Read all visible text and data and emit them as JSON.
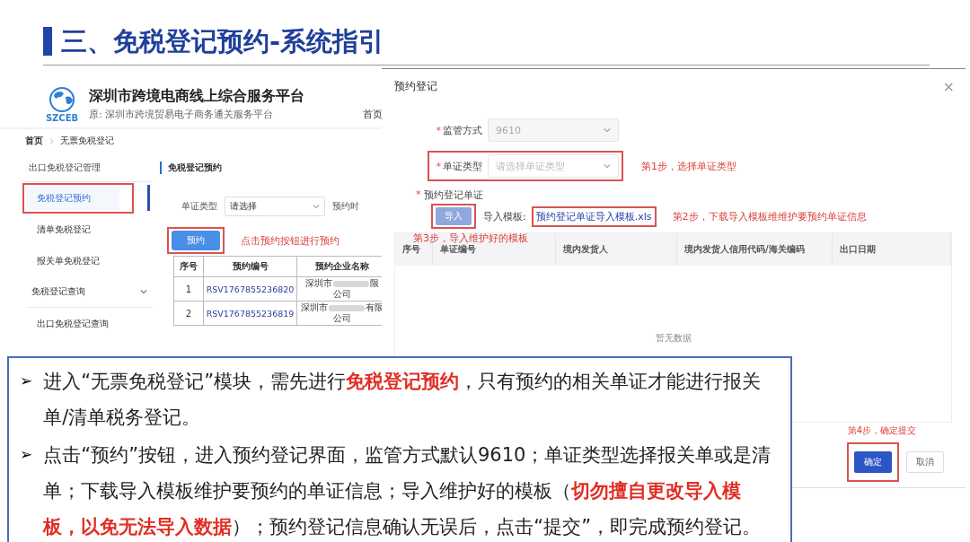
{
  "slide_title": "三、免税登记预约-系统指引",
  "portal": {
    "logo_text": "SZCEB",
    "title": "深圳市跨境电商线上综合服务平台",
    "subtitle": "原:  深圳市跨境贸易电子商务通关服务平台",
    "nav_link": "首页",
    "breadcrumb": [
      "首页",
      "无票免税登记"
    ],
    "sidebar": [
      {
        "label": "出口免税登记管理",
        "kind": "header",
        "selected": false,
        "highlighted": false
      },
      {
        "label": "免税登记预约",
        "kind": "item",
        "selected": true,
        "highlighted": true
      },
      {
        "label": "清单免税登记",
        "kind": "item",
        "selected": false,
        "highlighted": false
      },
      {
        "label": "报关单免税登记",
        "kind": "item",
        "selected": false,
        "highlighted": false
      },
      {
        "label": "免税登记查询",
        "kind": "group",
        "selected": false,
        "highlighted": false
      },
      {
        "label": "出口免税登记查询",
        "kind": "item",
        "selected": false,
        "highlighted": false
      }
    ],
    "section_title": "免税登记预约",
    "filter": {
      "label": "单证类型",
      "value": "请选择",
      "next_label": "预约时"
    },
    "button": "预约",
    "annotation": "点击预约按钮进行预约",
    "columns": [
      "序号",
      "预约编号",
      "预约企业名称"
    ],
    "rows": [
      {
        "index": "1",
        "number": "RSV1767855236820",
        "company_start": "深圳市",
        "company_end": "限",
        "company_line2": "公司"
      },
      {
        "index": "2",
        "number": "RSV1767855236819",
        "company_start": "深圳市",
        "company_end": "有限",
        "company_line2": "公司"
      }
    ]
  },
  "dialog": {
    "title": "预约登记",
    "close": "×",
    "fields": [
      {
        "marker": "*",
        "label": "监管方式",
        "value": "9610",
        "disabled": true,
        "highlighted": false
      },
      {
        "marker": "*",
        "label": "单证类型",
        "placeholder": "请选择单证类型",
        "disabled": false,
        "highlighted": true,
        "annotation": "第1步，选择单证类型"
      }
    ],
    "upload_marker": "*",
    "upload_label": "预约登记单证",
    "import_button": "导入",
    "template_label": "导入模板:",
    "template_link": "预约登记单证导入模板.xls",
    "step2": "第2步，下载导入模板维维护要预约单证信息",
    "step3": "第3步，导入维护好的模板",
    "columns": [
      "序号",
      "单证编号",
      "境内发货人",
      "境内发货人信用代码/海关编码",
      "出口日期"
    ],
    "empty_text": "暂无数据",
    "step4": "第4步，确定提交",
    "buttons": [
      {
        "label": "确定",
        "kind": "primary",
        "highlighted": true
      },
      {
        "label": "取消",
        "kind": "default",
        "highlighted": false
      }
    ]
  },
  "notes": [
    {
      "bullet": "➢",
      "text": "进入“无票免税登记”模块，需先进行**免税登记预约**，只有预约的相关单证才能进行报关单/清单税务登记。"
    },
    {
      "bullet": "➢",
      "text": "点击“预约”按钮，进入预约登记界面，监管方式默认9610；单证类型选择报关单或是清单；下载导入模板维护要预约的单证信息；导入维护好的模板（**切勿擅自更改导入模板，以免无法导入数据**）；预约登记信息确认无误后，点击“提交”，即完成预约登记。"
    }
  ]
}
